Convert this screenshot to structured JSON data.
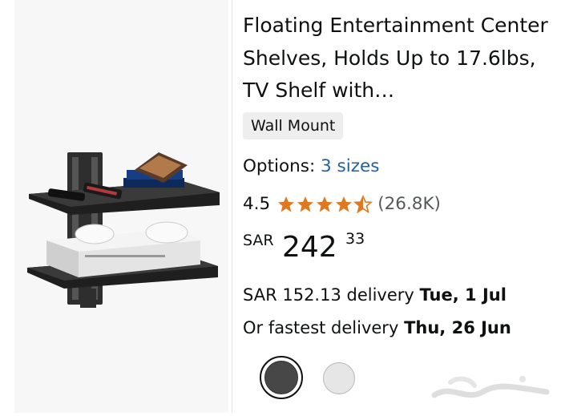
{
  "product": {
    "title": "Floating Entertainment Center Shelves, Holds Up to 17.6lbs, TV Shelf with…",
    "style_badge": "Wall Mount",
    "options_label": "Options:",
    "options_link": "3 sizes",
    "rating_value": "4.5",
    "rating_stars": 4.5,
    "review_count": "(26.8K)",
    "price_currency": "SAR",
    "price_whole": "242",
    "price_fraction": "33",
    "delivery_text": "SAR 152.13 delivery",
    "delivery_date": "Tue, 1 Jul",
    "fastest_text": "Or fastest delivery",
    "fastest_date": "Thu, 26 Jun",
    "swatches": [
      {
        "name": "black",
        "color": "#474747",
        "selected": true
      },
      {
        "name": "white",
        "color": "#e6e6e6",
        "selected": false
      }
    ]
  },
  "colors": {
    "star": "#de7921",
    "link": "#2162a1",
    "text": "#0f1111"
  },
  "watermark": "haraj-logo"
}
